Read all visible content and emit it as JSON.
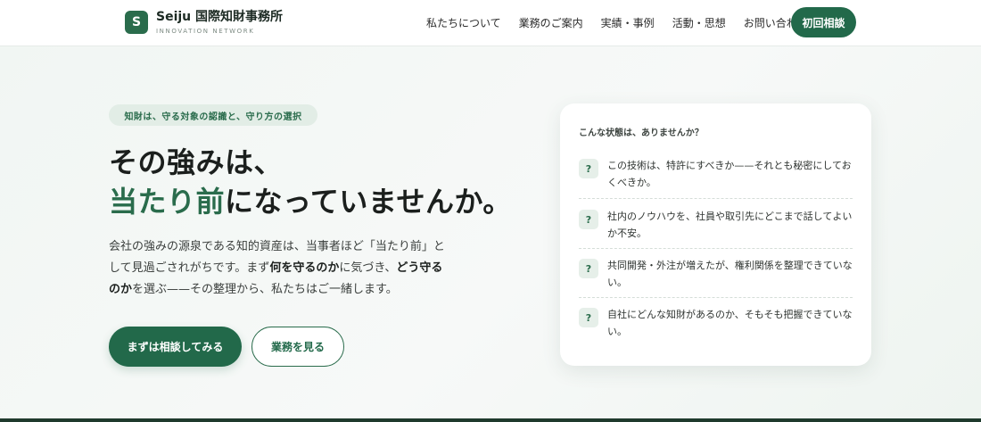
{
  "brand": {
    "mark": "S",
    "name": "Seiju 国際知財事務所",
    "sub": "INNOVATION NETWORK"
  },
  "nav": {
    "items": [
      "私たちについて",
      "業務のご案内",
      "実績・事例",
      "活動・思想",
      "お問い合わせ"
    ],
    "cta": "初回相談"
  },
  "hero": {
    "tagline": "知財は、守る対象の認識と、守り方の選択",
    "headline_line1": "その強みは、",
    "headline_accent": "当たり前",
    "headline_rest": "になっていませんか。",
    "lead": {
      "part1": "会社の強みの源泉である知的資産は、当事者ほど「当たり前」として見過ごされがちです。まず",
      "bold1": "何を守るのか",
      "part2": "に気づき、",
      "bold2": "どう守るのか",
      "part3": "を選ぶ——その整理から、私たちはご一緒します。"
    },
    "primary_button": "まずは相談してみる",
    "secondary_button": "業務を見る"
  },
  "card": {
    "title": "こんな状態は、ありませんか？",
    "icon": "?",
    "items": [
      "この技術は、特許にすべきか——それとも秘密にしておくべきか。",
      "社内のノウハウを、社員や取引先にどこまで話してよいか不安。",
      "共同開発・外注が増えたが、権利関係を整理できていない。",
      "自社にどんな知財があるのか、そもそも把握できていない。"
    ]
  },
  "colors": {
    "accent": "#2a6c4c",
    "button": "#22694a",
    "background": "#f4f7f5"
  }
}
